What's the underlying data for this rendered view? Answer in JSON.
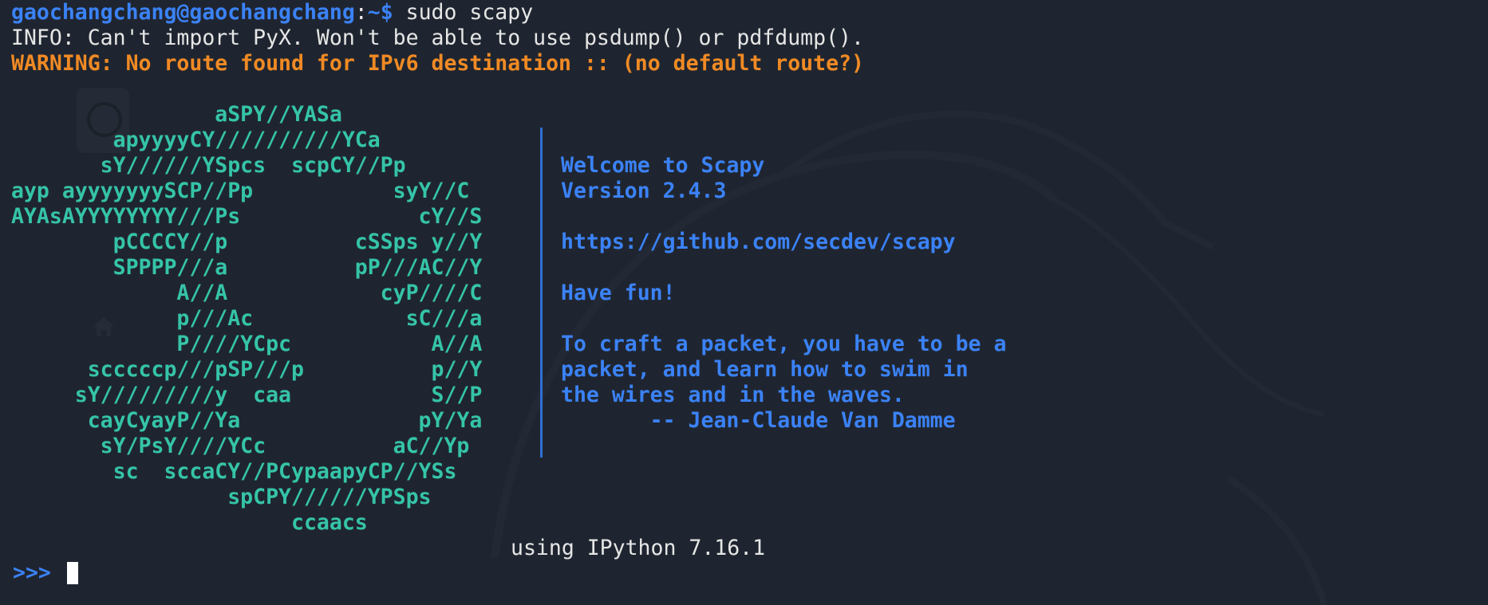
{
  "terminal": {
    "command_line": {
      "user_host": "gaochangchang@gaochangchang",
      "separator": ":",
      "path_prompt": "~$",
      "command": " sudo scapy"
    },
    "info_line": "INFO: Can't import PyX. Won't be able to use psdump() or pdfdump().",
    "warning_line": "WARNING: No route found for IPv6 destination :: (no default route?)",
    "ascii_art": [
      "                aSPY//YASa",
      "        apyyyyCY//////////YCa",
      "       sY//////YSpcs  scpCY//Pp",
      "ayp ayyyyyyySCP//Pp           syY//C",
      "AYAsAYYYYYYYY///Ps              cY//S",
      "        pCCCCY//p          cSSps y//Y",
      "        SPPPP///a          pP///AC//Y",
      "             A//A            cyP////C",
      "             p///Ac            sC///a",
      "             P////YCpc           A//A",
      "      scccccp///pSP///p          p//Y",
      "     sY/////////y  caa           S//P",
      "      cayCyayP//Ya              pY/Ya",
      "       sY/PsY////YCc          aC//Yp",
      "        sc  sccaCY//PCypaapyCP//YSs",
      "                 spCPY//////YPSps",
      "                      ccaacs"
    ],
    "welcome_lines": [
      "Welcome to Scapy",
      "Version 2.4.3",
      "",
      "https://github.com/secdev/scapy",
      "",
      "Have fun!",
      "",
      "To craft a packet, you have to be a",
      "packet, and learn how to swim in",
      "the wires and in the waves.",
      "       -- Jean-Claude Van Damme"
    ],
    "ipython_note": "using IPython 7.16.1",
    "input_prompt": ">>>"
  },
  "colors": {
    "background": "#1f2530",
    "prompt_blue": "#3b82f6",
    "warning_orange": "#f08a24",
    "art_teal": "#35c4a8",
    "text": "#e6e6e6"
  },
  "icons": [
    "disk-icon",
    "home-icon",
    "kali-dragon-watermark"
  ]
}
